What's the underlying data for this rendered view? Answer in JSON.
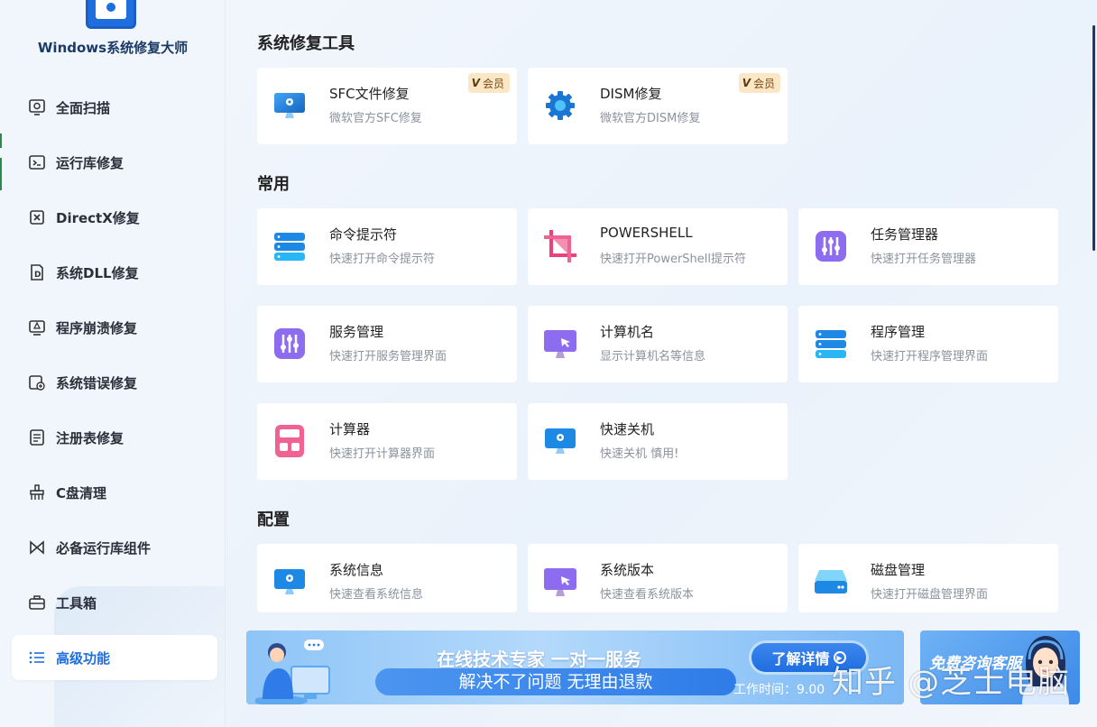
{
  "app": {
    "title": "Windows系统修复大师"
  },
  "sidebar": {
    "items": [
      {
        "label": "全面扫描",
        "icon": "scan-icon"
      },
      {
        "label": "运行库修复",
        "icon": "terminal-icon"
      },
      {
        "label": "DirectX修复",
        "icon": "directx-icon"
      },
      {
        "label": "系统DLL修复",
        "icon": "dll-icon"
      },
      {
        "label": "程序崩溃修复",
        "icon": "crash-icon"
      },
      {
        "label": "系统错误修复",
        "icon": "error-icon"
      },
      {
        "label": "注册表修复",
        "icon": "registry-icon"
      },
      {
        "label": "C盘清理",
        "icon": "broom-icon"
      },
      {
        "label": "必备运行库组件",
        "icon": "components-icon"
      },
      {
        "label": "工具箱",
        "icon": "toolbox-icon"
      },
      {
        "label": "高级功能",
        "icon": "list-icon",
        "active": true
      }
    ]
  },
  "sections": {
    "repair": {
      "title": "系统修复工具",
      "cards": [
        {
          "title": "SFC文件修复",
          "desc": "微软官方SFC修复",
          "badge": "会员",
          "badge_mark": "V"
        },
        {
          "title": "DISM修复",
          "desc": "微软官方DISM修复",
          "badge": "会员",
          "badge_mark": "V"
        }
      ]
    },
    "common": {
      "title": "常用",
      "cards": [
        {
          "title": "命令提示符",
          "desc": "快速打开命令提示符"
        },
        {
          "title": "POWERSHELL",
          "desc": "快速打开PowerShell提示符"
        },
        {
          "title": "任务管理器",
          "desc": "快速打开任务管理器"
        },
        {
          "title": "服务管理",
          "desc": "快速打开服务管理界面"
        },
        {
          "title": "计算机名",
          "desc": "显示计算机名等信息"
        },
        {
          "title": "程序管理",
          "desc": "快速打开程序管理界面"
        },
        {
          "title": "计算器",
          "desc": "快速打开计算器界面"
        },
        {
          "title": "快速关机",
          "desc": "快速关机 慎用!"
        }
      ]
    },
    "config": {
      "title": "配置",
      "cards": [
        {
          "title": "系统信息",
          "desc": "快速查看系统信息"
        },
        {
          "title": "系统版本",
          "desc": "快速查看系统版本"
        },
        {
          "title": "磁盘管理",
          "desc": "快速打开磁盘管理界面"
        }
      ]
    }
  },
  "banner": {
    "headline": "在线技术专家 一对一服务",
    "subline": "解决不了问题 无理由退款",
    "button": "了解详情",
    "hours": "工作时间：9.00"
  },
  "consult": {
    "label": "免费咨询客服"
  },
  "watermark": "知乎 @芝士电脑",
  "colors": {
    "accent": "#1f6ee0",
    "badge_bg": "#fbe7c6",
    "card_bg": "#ffffff"
  }
}
